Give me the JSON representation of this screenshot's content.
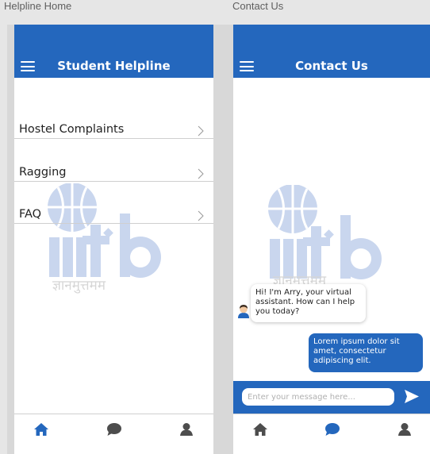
{
  "left_frame": {
    "label": "Helpline Home",
    "header_title": "Student Helpline",
    "menu_items": [
      {
        "label": "Hostel Complaints"
      },
      {
        "label": "Ragging"
      },
      {
        "label": "FAQ"
      }
    ],
    "nav": [
      {
        "icon": "home-icon",
        "active": true
      },
      {
        "icon": "chat-icon",
        "active": false
      },
      {
        "icon": "profile-icon",
        "active": false
      }
    ]
  },
  "right_frame": {
    "label": "Contact Us",
    "header_title": "Contact Us",
    "messages": [
      {
        "sender": "bot",
        "avatar": "bot-avatar-icon",
        "text": "Hi! I'm Arry, your virtual assistant. How can I help you today?"
      },
      {
        "sender": "user",
        "text": "Lorem ipsum dolor sit amet, consectetur adipiscing elit."
      }
    ],
    "input_placeholder": "Enter your message here...",
    "nav": [
      {
        "icon": "home-icon",
        "active": false
      },
      {
        "icon": "chat-icon",
        "active": true
      },
      {
        "icon": "profile-icon",
        "active": false
      }
    ]
  },
  "watermark": {
    "logo_text": "iiit·b",
    "tagline": "ज्ञानमुत्तमम"
  },
  "colors": {
    "primary": "#2467bd",
    "inactive_icon": "#4d4d4d",
    "watermark": "#c9d6ee"
  }
}
